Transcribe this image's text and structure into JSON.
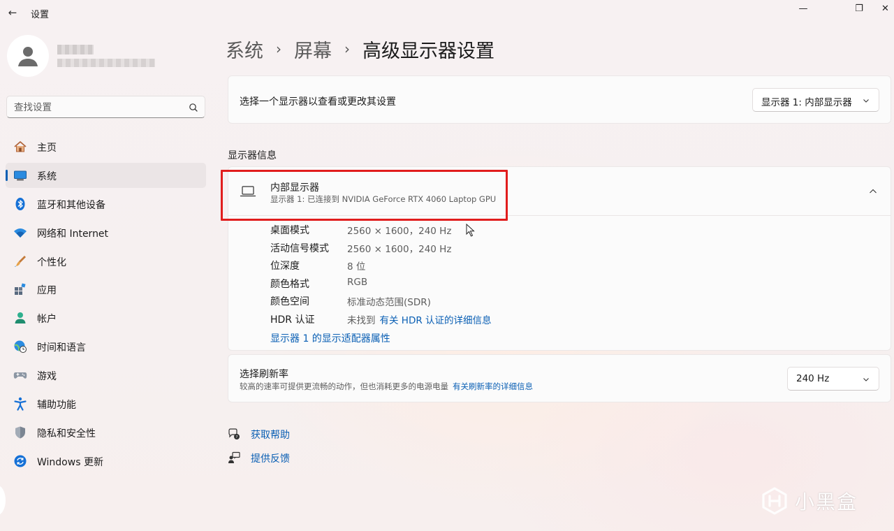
{
  "window": {
    "title": "设置",
    "back_glyph": "←",
    "minimize_glyph": "—",
    "restore_glyph": "❐",
    "close_glyph": "✕"
  },
  "search": {
    "placeholder": "查找设置",
    "icon": "search-icon"
  },
  "sidebar": {
    "items": [
      {
        "label": "主页",
        "icon": "home-icon"
      },
      {
        "label": "系统",
        "icon": "monitor-icon",
        "active": true
      },
      {
        "label": "蓝牙和其他设备",
        "icon": "bluetooth-icon"
      },
      {
        "label": "网络和 Internet",
        "icon": "wifi-icon"
      },
      {
        "label": "个性化",
        "icon": "brush-icon"
      },
      {
        "label": "应用",
        "icon": "apps-icon"
      },
      {
        "label": "帐户",
        "icon": "account-icon"
      },
      {
        "label": "时间和语言",
        "icon": "globe-clock-icon"
      },
      {
        "label": "游戏",
        "icon": "gamepad-icon"
      },
      {
        "label": "辅助功能",
        "icon": "accessibility-icon"
      },
      {
        "label": "隐私和安全性",
        "icon": "shield-icon"
      },
      {
        "label": "Windows 更新",
        "icon": "update-icon"
      }
    ]
  },
  "breadcrumb": {
    "items": [
      "系统",
      "屏幕",
      "高级显示器设置"
    ],
    "separator": "›"
  },
  "monitor_select": {
    "label": "选择一个显示器以查看或更改其设置",
    "selected": "显示器 1: 内部显示器"
  },
  "display_info": {
    "section_title": "显示器信息",
    "title": "内部显示器",
    "subtitle": "显示器 1: 已连接到 NVIDIA GeForce RTX 4060 Laptop GPU",
    "properties": [
      {
        "key": "桌面模式",
        "value": "2560 × 1600，240 Hz"
      },
      {
        "key": "活动信号模式",
        "value": "2560 × 1600，240 Hz"
      },
      {
        "key": "位深度",
        "value": "8 位"
      },
      {
        "key": "颜色格式",
        "value": "RGB"
      },
      {
        "key": "颜色空间",
        "value": "标准动态范围(SDR)"
      },
      {
        "key": "HDR 认证",
        "value": "未找到",
        "link": "有关 HDR 认证的详细信息"
      }
    ],
    "adapter_link": "显示器 1 的显示适配器属性"
  },
  "refresh_rate": {
    "title": "选择刷新率",
    "description": "较高的速率可提供更流畅的动作，但也消耗更多的电源电量",
    "link": "有关刷新率的详细信息",
    "selected": "240 Hz"
  },
  "help": {
    "get_help": "获取帮助",
    "feedback": "提供反馈"
  },
  "watermark": {
    "text": "小黑盒"
  },
  "colors": {
    "accent": "#0a5fb4",
    "highlight": "#e11d1d"
  }
}
